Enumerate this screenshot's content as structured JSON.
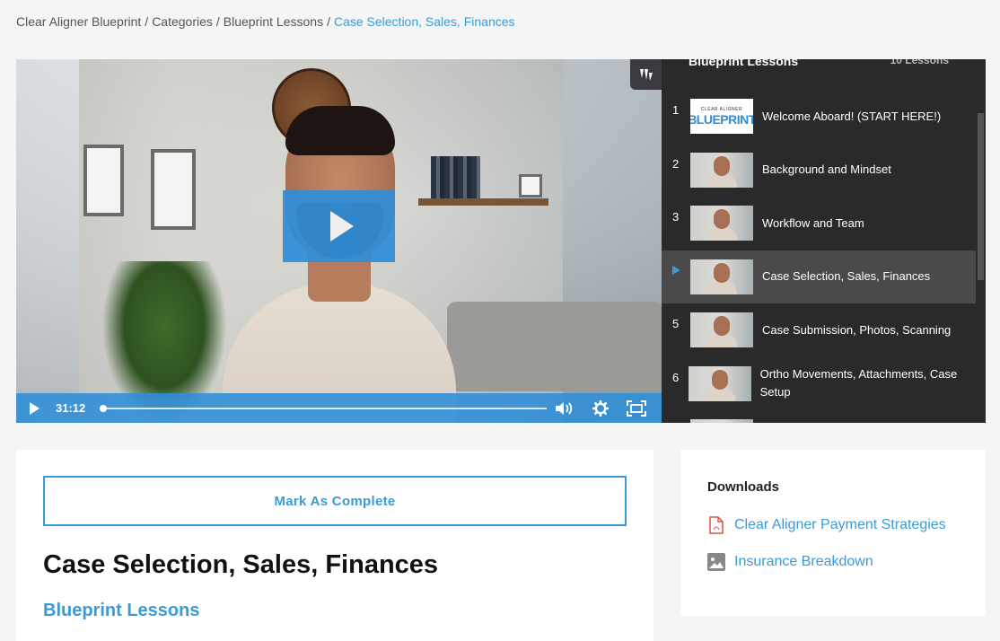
{
  "breadcrumb": {
    "items": [
      "Clear Aligner Blueprint",
      "Categories",
      "Blueprint Lessons"
    ],
    "separator": "/",
    "current": "Case Selection, Sales, Finances"
  },
  "video": {
    "time": "31:12",
    "progress": 0.0
  },
  "lessons_panel": {
    "title": "Blueprint Lessons",
    "count": "10 Lessons",
    "items": [
      {
        "num": "1",
        "title": "Welcome Aboard! (START HERE!)",
        "thumb_top": "CLEAR ALIGNER",
        "thumb_main": "BLUEPRINT"
      },
      {
        "num": "2",
        "title": "Background and Mindset"
      },
      {
        "num": "3",
        "title": "Workflow and Team"
      },
      {
        "num": "",
        "title": "Case Selection, Sales, Finances"
      },
      {
        "num": "5",
        "title": "Case Submission, Photos, Scanning"
      },
      {
        "num": "6",
        "title": "Ortho Movements, Attachments, Case Setup"
      }
    ]
  },
  "main": {
    "complete_label": "Mark As Complete",
    "lesson_title": "Case Selection, Sales, Finances",
    "course_link": "Blueprint Lessons"
  },
  "downloads": {
    "heading": "Downloads",
    "items": [
      {
        "label": "Clear Aligner Payment Strategies",
        "icon": "pdf-icon"
      },
      {
        "label": "Insurance Breakdown",
        "icon": "image-icon"
      }
    ]
  },
  "colors": {
    "accent": "#3a9bd9",
    "video_controls": "#2f8ed8",
    "panel_bg": "#2a2a2a",
    "active_row": "#4a4a4a"
  }
}
